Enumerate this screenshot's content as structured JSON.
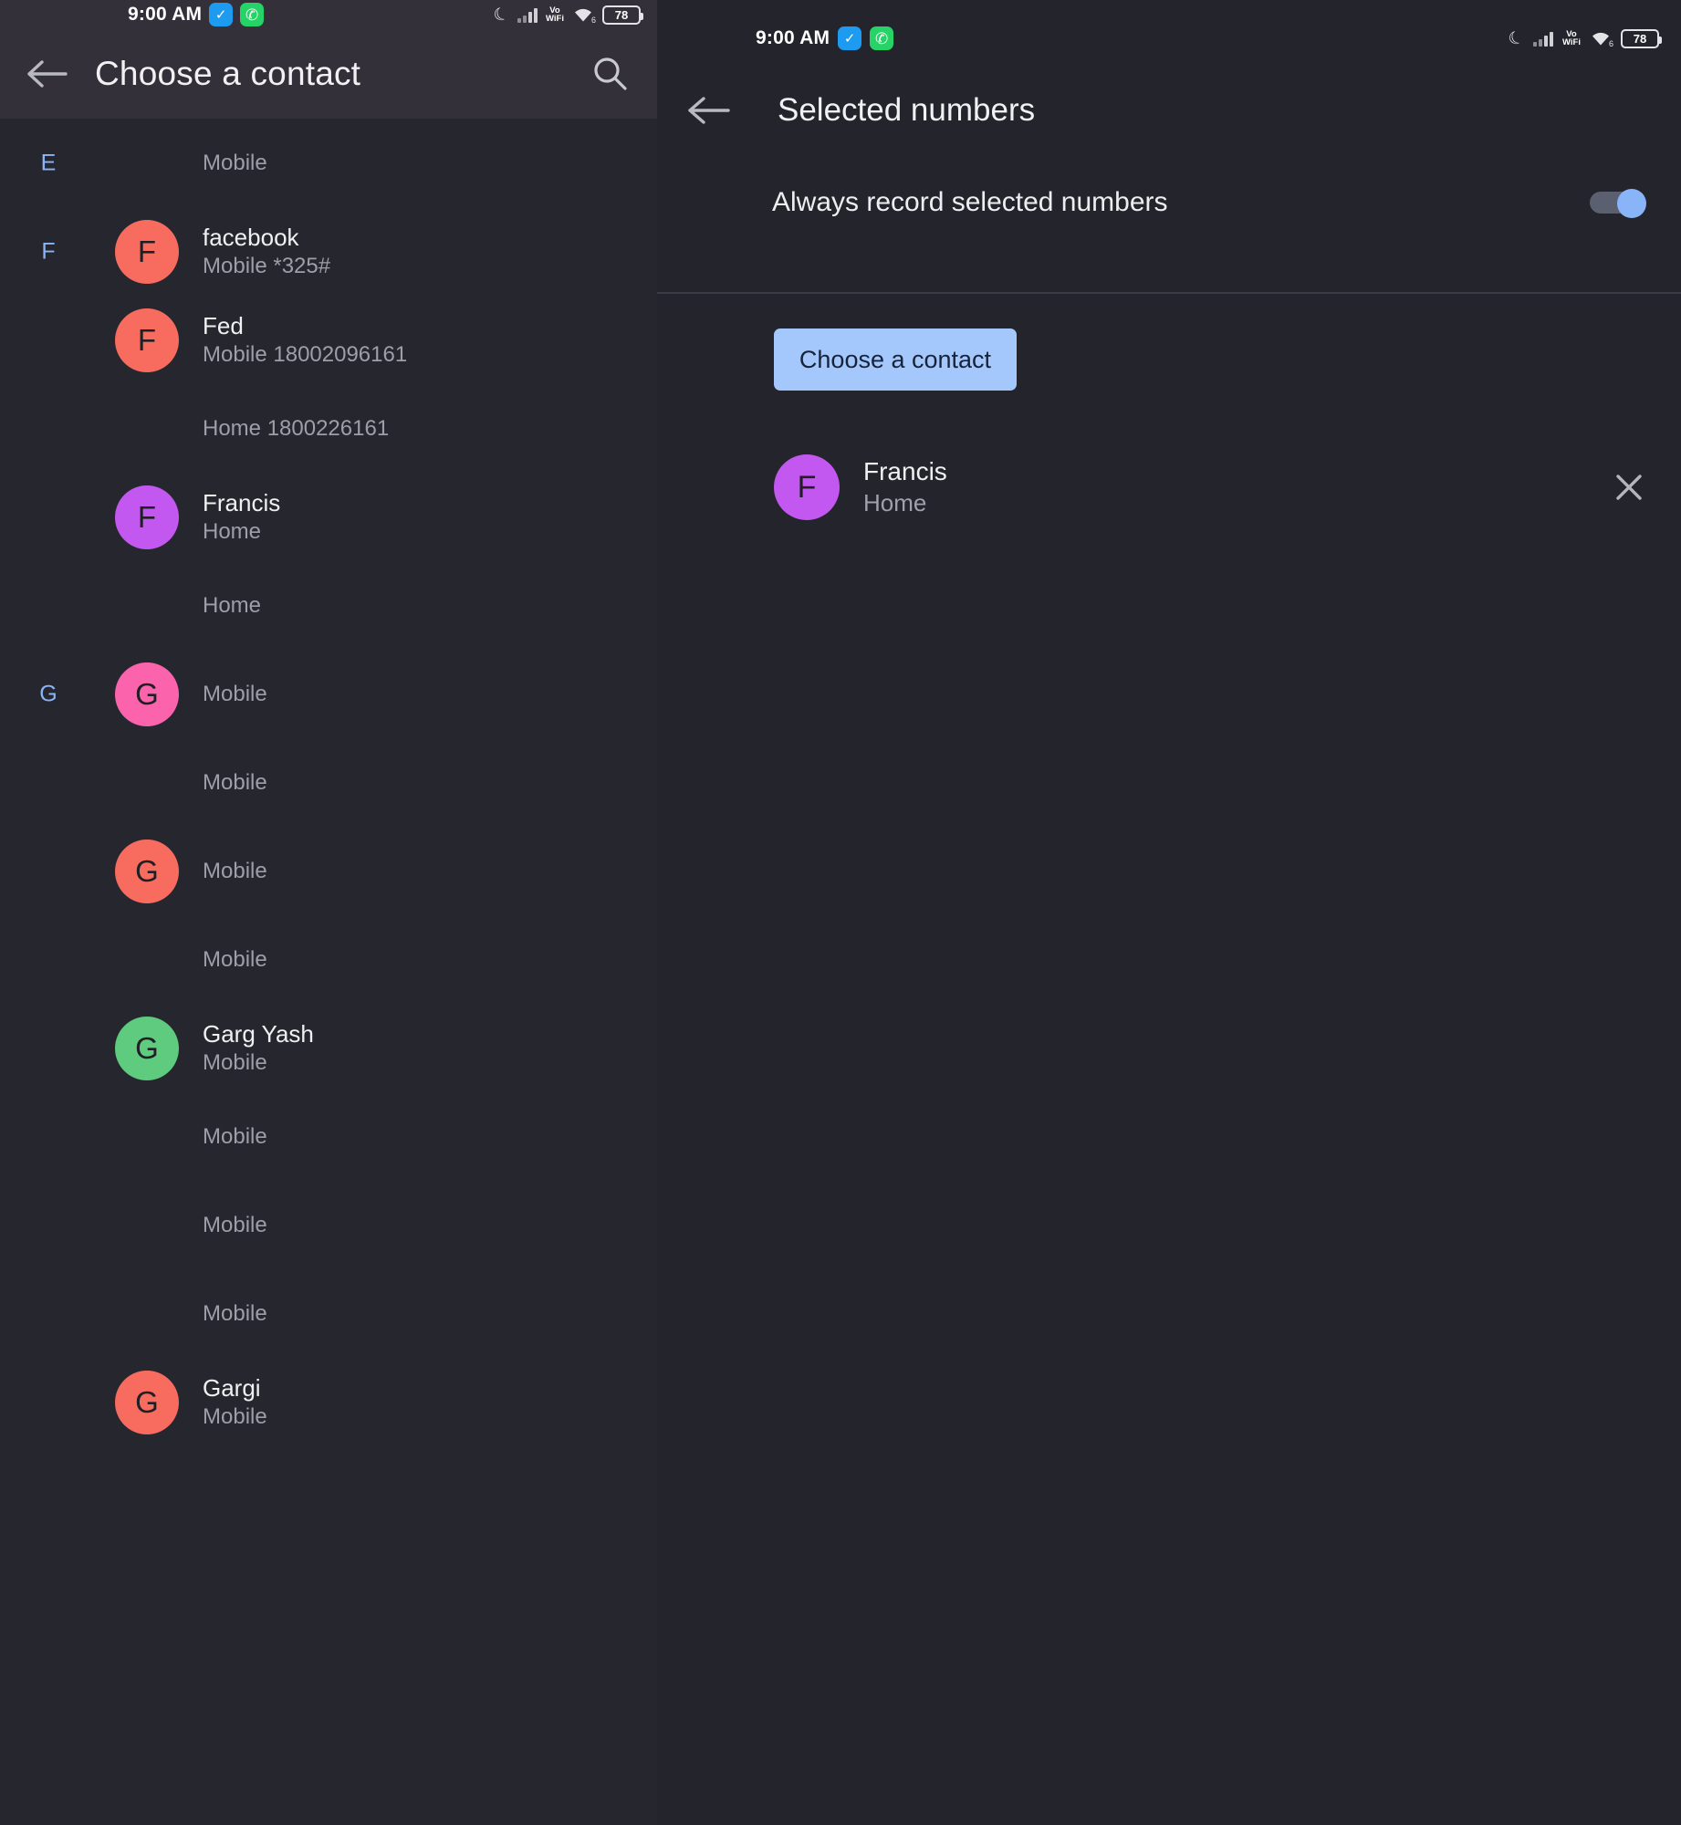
{
  "left_pane": {
    "status_bar": {
      "time": "9:00 AM",
      "icons": {
        "verified_badge": "verified-badge-icon",
        "whatsapp_badge": "whatsapp-badge-icon",
        "dnd": "moon-icon",
        "signal": "cellular-signal-icon",
        "volte_line1": "Vo",
        "volte_line2": "WiFi",
        "wifi": "wifi-icon",
        "wifi_gen": "6",
        "battery_percent": "78"
      }
    },
    "app_bar": {
      "back": "back-arrow-icon",
      "title": "Choose a contact",
      "search": "search-icon"
    },
    "rows": [
      {
        "index": "E",
        "avatar": null,
        "avatar_color": "",
        "avatar_letter": "",
        "name": "",
        "sub": "Mobile"
      },
      {
        "index": "F",
        "avatar": true,
        "avatar_color": "#f76c5e",
        "avatar_letter": "F",
        "name": "facebook",
        "sub": "Mobile  *325#"
      },
      {
        "index": "",
        "avatar": true,
        "avatar_color": "#f76c5e",
        "avatar_letter": "F",
        "name": "Fed",
        "sub": "Mobile  18002096161"
      },
      {
        "index": "",
        "avatar": null,
        "avatar_color": "",
        "avatar_letter": "",
        "name": "",
        "sub": "Home  1800226161"
      },
      {
        "index": "",
        "avatar": true,
        "avatar_color": "#c258f0",
        "avatar_letter": "F",
        "name": "Francis",
        "sub": "Home"
      },
      {
        "index": "",
        "avatar": null,
        "avatar_color": "",
        "avatar_letter": "",
        "name": "",
        "sub": "Home"
      },
      {
        "index": "G",
        "avatar": true,
        "avatar_color": "#fb64ad",
        "avatar_letter": "G",
        "name": "",
        "sub": "Mobile"
      },
      {
        "index": "",
        "avatar": null,
        "avatar_color": "",
        "avatar_letter": "",
        "name": "",
        "sub": "Mobile"
      },
      {
        "index": "",
        "avatar": true,
        "avatar_color": "#f76c5e",
        "avatar_letter": "G",
        "name": "",
        "sub": "Mobile"
      },
      {
        "index": "",
        "avatar": null,
        "avatar_color": "",
        "avatar_letter": "",
        "name": "",
        "sub": "Mobile"
      },
      {
        "index": "",
        "avatar": true,
        "avatar_color": "#5ecb7e",
        "avatar_letter": "G",
        "name": "Garg Yash",
        "sub": "Mobile"
      },
      {
        "index": "",
        "avatar": null,
        "avatar_color": "",
        "avatar_letter": "",
        "name": "",
        "sub": "Mobile"
      },
      {
        "index": "",
        "avatar": null,
        "avatar_color": "",
        "avatar_letter": "",
        "name": "",
        "sub": "Mobile"
      },
      {
        "index": "",
        "avatar": null,
        "avatar_color": "",
        "avatar_letter": "",
        "name": "",
        "sub": "Mobile"
      },
      {
        "index": "",
        "avatar": true,
        "avatar_color": "#f76c5e",
        "avatar_letter": "G",
        "name": "Gargi",
        "sub": "Mobile"
      }
    ]
  },
  "right_pane": {
    "status_bar": {
      "time": "9:00 AM",
      "icons": {
        "verified_badge": "verified-badge-icon",
        "whatsapp_badge": "whatsapp-badge-icon",
        "dnd": "moon-icon",
        "signal": "cellular-signal-icon",
        "volte_line1": "Vo",
        "volte_line2": "WiFi",
        "wifi": "wifi-icon",
        "wifi_gen": "6",
        "battery_percent": "78"
      }
    },
    "app_bar": {
      "back": "back-arrow-icon",
      "title": "Selected numbers"
    },
    "toggle": {
      "label": "Always record selected numbers",
      "state": "on",
      "track_color": "#5b6070",
      "thumb_color": "#8ab4f8"
    },
    "choose_button": {
      "label": "Choose a contact",
      "background": "#a5c8fc",
      "text_color": "#17233a"
    },
    "selected_contact": {
      "avatar_letter": "F",
      "avatar_color": "#c258f0",
      "name": "Francis",
      "sub": "Home",
      "remove": "close-icon"
    }
  }
}
